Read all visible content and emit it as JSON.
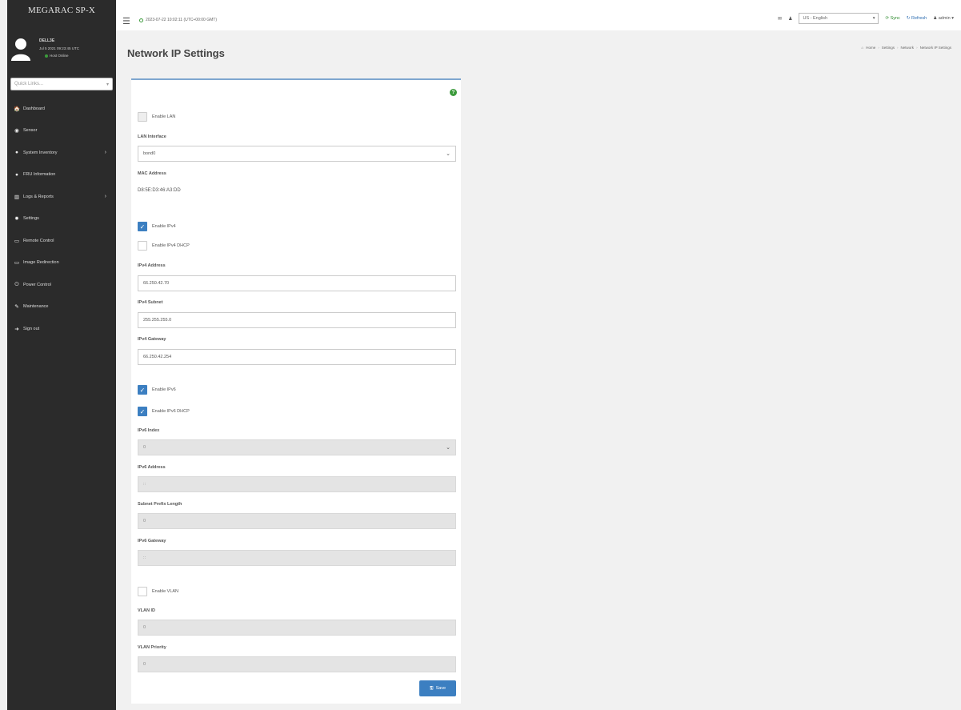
{
  "sidebar": {
    "logo": "MEGARAC SP-X",
    "user": {
      "name": "DELL3E",
      "date": "Jul 5 2021 09:23:45 UTC",
      "status": "Host Online"
    },
    "quick_links_placeholder": "Quick Links...",
    "items": [
      {
        "label": "Dashboard",
        "icon": "dashboard-icon",
        "glyph": "🏠",
        "expandable": false
      },
      {
        "label": "Sensor",
        "icon": "sensor-icon",
        "glyph": "◉",
        "expandable": false
      },
      {
        "label": "System Inventory",
        "icon": "inventory-icon",
        "glyph": "●",
        "expandable": true
      },
      {
        "label": "FRU Information",
        "icon": "info-icon",
        "glyph": "●",
        "expandable": false
      },
      {
        "label": "Logs & Reports",
        "icon": "chart-icon",
        "glyph": "▥",
        "expandable": true
      },
      {
        "label": "Settings",
        "icon": "gear-icon",
        "glyph": "✹",
        "expandable": false
      },
      {
        "label": "Remote Control",
        "icon": "monitor-icon",
        "glyph": "▭",
        "expandable": false
      },
      {
        "label": "Image Redirection",
        "icon": "media-icon",
        "glyph": "▭",
        "expandable": false
      },
      {
        "label": "Power Control",
        "icon": "power-icon",
        "glyph": "⏻",
        "expandable": false
      },
      {
        "label": "Maintenance",
        "icon": "wrench-icon",
        "glyph": "✎",
        "expandable": false
      },
      {
        "label": "Sign out",
        "icon": "signout-icon",
        "glyph": "➜",
        "expandable": false
      }
    ]
  },
  "header": {
    "datetime": "2023-07-22 10:02:11 (UTC+00:00 GMT)",
    "language": "US - English",
    "sync": "Sync",
    "refresh": "Refresh",
    "user": "admin"
  },
  "page": {
    "title": "Network IP Settings",
    "breadcrumb": [
      "Home",
      "Settings",
      "Network",
      "Network IP Settings"
    ]
  },
  "form": {
    "enable_lan": {
      "label": "Enable LAN",
      "checked": false
    },
    "lan_interface": {
      "label": "LAN Interface",
      "value": "bond0"
    },
    "mac_address": {
      "label": "MAC Address",
      "value": "D8:5E:D3:46:A3:DD"
    },
    "enable_ipv4": {
      "label": "Enable IPv4",
      "checked": true
    },
    "enable_ipv4_dhcp": {
      "label": "Enable IPv4 DHCP",
      "checked": false
    },
    "ipv4_address": {
      "label": "IPv4 Address",
      "value": "66.250.42.70"
    },
    "ipv4_subnet": {
      "label": "IPv4 Subnet",
      "value": "255.255.255.0"
    },
    "ipv4_gateway": {
      "label": "IPv4 Gateway",
      "value": "66.250.42.254"
    },
    "enable_ipv6": {
      "label": "Enable IPv6",
      "checked": true
    },
    "enable_ipv6_dhcp": {
      "label": "Enable IPv6 DHCP",
      "checked": true
    },
    "ipv6_index": {
      "label": "IPv6 Index",
      "value": "0"
    },
    "ipv6_address": {
      "label": "IPv6 Address",
      "value": "::"
    },
    "subnet_prefix_length": {
      "label": "Subnet Prefix Length",
      "value": "0"
    },
    "ipv6_gateway": {
      "label": "IPv6 Gateway",
      "value": "::"
    },
    "enable_vlan": {
      "label": "Enable VLAN",
      "checked": false
    },
    "vlan_id": {
      "label": "VLAN ID",
      "value": "0"
    },
    "vlan_priority": {
      "label": "VLAN Priority",
      "value": "0"
    },
    "save_label": "Save"
  },
  "colors": {
    "sidebar_bg": "#2b2b2b",
    "accent": "#3c7fc1",
    "online": "#3c9b3c"
  }
}
